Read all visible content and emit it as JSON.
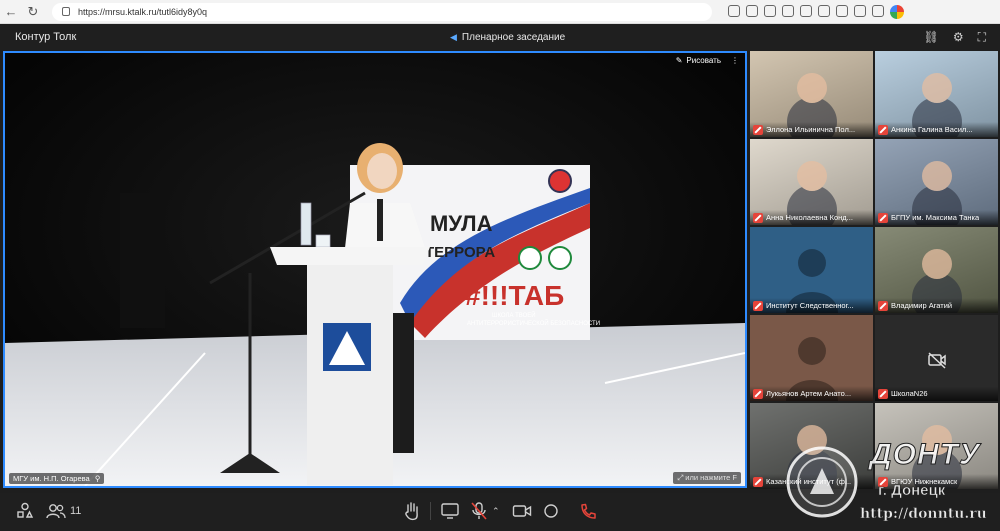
{
  "browser": {
    "url": "https://mrsu.ktalk.ru/tutl6idy8y0q"
  },
  "app": {
    "title": "Контур Толк",
    "meeting_title": "Пленарное заседание"
  },
  "stage": {
    "draw_label": "Рисовать",
    "caption": "МГУ им. Н.П. Огарева",
    "hint": "или нажмите F",
    "banner": {
      "line1": "МУЛА",
      "line2": "ТЕРРОРА",
      "brand": "#!!!ТАБ",
      "sub1": "ШКОЛА ТВОЕЙ",
      "sub2": "АНТИТЕРРОРИСТИЧЕСКОЙ БЕЗОПАСНОСТИ"
    }
  },
  "participants": [
    {
      "name": "Эллона Ильинична Пол...",
      "kind": "video",
      "bg": "#c9b9a0"
    },
    {
      "name": "Анкина Галина Васил...",
      "kind": "video",
      "bg": "#aac4d8"
    },
    {
      "name": "Анна Николаевна Конд...",
      "kind": "video",
      "bg": "#d8d0c2"
    },
    {
      "name": "БГПУ им. Максима Танка",
      "kind": "video",
      "bg": "#7d8fa6"
    },
    {
      "name": "Институт Следственног...",
      "kind": "avatar",
      "bg": "#2f5f86"
    },
    {
      "name": "Владимир Агатий",
      "kind": "video",
      "bg": "#6c7158"
    },
    {
      "name": "Лукьянов Артем Анато...",
      "kind": "avatar",
      "bg": "#7a5848"
    },
    {
      "name": "ШколаN26",
      "kind": "camera-off",
      "bg": "#2a2a2a"
    },
    {
      "name": "Казанский институт (ф...",
      "kind": "video",
      "bg": "#50524f"
    },
    {
      "name": "ВГЮУ Нижнекамск",
      "kind": "video",
      "bg": "#b9b5ac"
    }
  ],
  "toolbar": {
    "participants_count": "11"
  },
  "watermark": {
    "title": "ДОНТУ",
    "city": "г. Донецк",
    "url": "http://donntu.ru"
  },
  "colors": {
    "accent": "#2e8bff",
    "mic_off": "#e5443a",
    "hangup": "#e5443a"
  }
}
